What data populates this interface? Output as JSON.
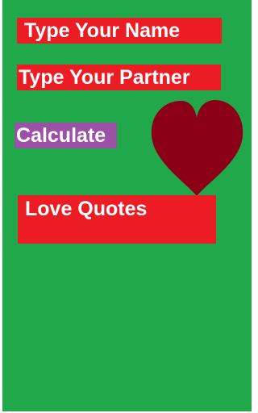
{
  "form": {
    "name_placeholder": "Type Your Name",
    "partner_placeholder": "Type Your Partner"
  },
  "actions": {
    "calculate_label": "Calculate",
    "quotes_label": "Love Quotes"
  },
  "icons": {
    "heart": "heart-icon"
  },
  "colors": {
    "background": "#21a84b",
    "field": "#ec1c24",
    "calculate": "#9b51a6",
    "heart": "#8b0016",
    "text": "#ffffff"
  }
}
